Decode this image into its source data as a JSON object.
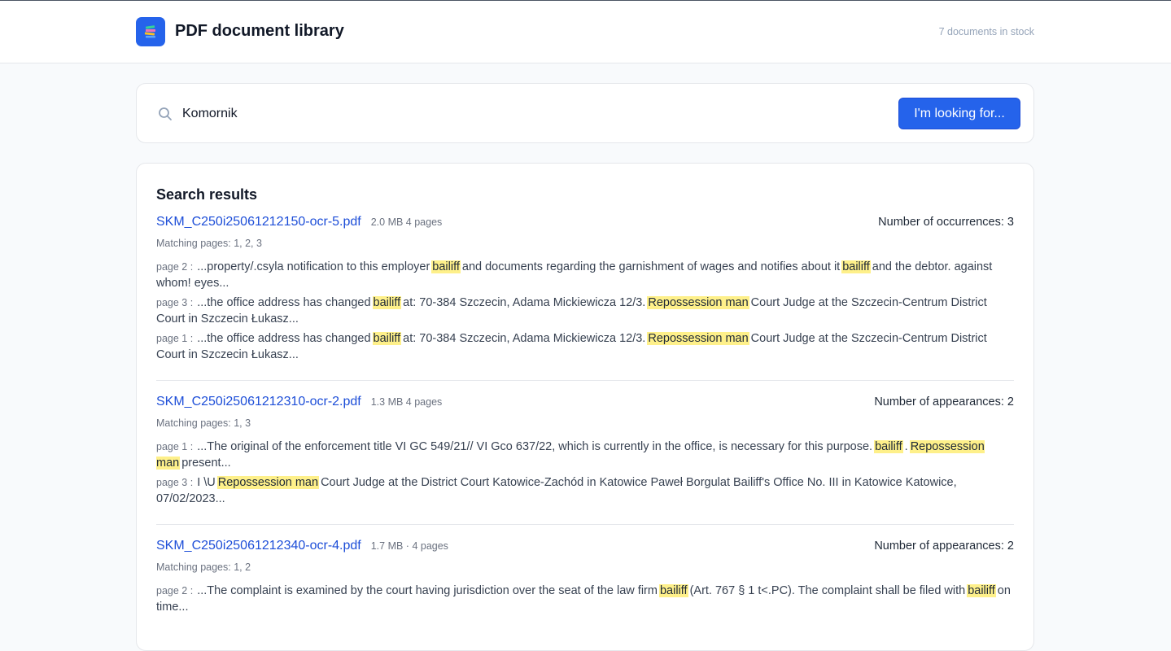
{
  "header": {
    "title": "PDF document library",
    "stock": "7 documents in stock"
  },
  "search": {
    "value": "Komornik",
    "button": "I'm looking for..."
  },
  "results": {
    "heading": "Search results",
    "items": [
      {
        "file": "SKM_C250i25061212150-ocr-5.pdf",
        "meta": "2.0 MB 4 pages",
        "count_label": "Number of occurrences: 3",
        "matching": "Matching pages: 1, 2, 3",
        "snippets": [
          {
            "label": "page 2 :",
            "parts": [
              {
                "t": "...property/.csyla notification to this employer"
              },
              {
                "t": "bailiff",
                "hl": true
              },
              {
                "t": "and documents regarding the garnishment of wages and notifies about it"
              },
              {
                "t": "bailiff",
                "hl": true
              },
              {
                "t": "and the debtor. against whom! eyes..."
              }
            ]
          },
          {
            "label": "page 3 :",
            "parts": [
              {
                "t": "...the office address has changed"
              },
              {
                "t": "bailiff",
                "hl": true
              },
              {
                "t": "at: 70-384 Szczecin, Adama Mickiewicza 12/3."
              },
              {
                "t": "Repossession man",
                "hl": true
              },
              {
                "t": "Court Judge at the Szczecin-Centrum District Court in Szczecin Łukasz..."
              }
            ]
          },
          {
            "label": "page 1 :",
            "parts": [
              {
                "t": "...the office address has changed"
              },
              {
                "t": "bailiff",
                "hl": true
              },
              {
                "t": "at: 70-384 Szczecin, Adama Mickiewicza 12/3."
              },
              {
                "t": "Repossession man",
                "hl": true
              },
              {
                "t": "Court Judge at the Szczecin-Centrum District Court in Szczecin Łukasz..."
              }
            ]
          }
        ]
      },
      {
        "file": "SKM_C250i25061212310-ocr-2.pdf",
        "meta": "1.3 MB 4 pages",
        "count_label": "Number of appearances: 2",
        "matching": "Matching pages: 1, 3",
        "snippets": [
          {
            "label": "page 1 :",
            "parts": [
              {
                "t": "...The original of the enforcement title VI GC 549/21// VI Gco 637/22, which is currently in the office, is necessary for this purpose."
              },
              {
                "t": "bailiff",
                "hl": true
              },
              {
                "t": "."
              },
              {
                "t": "Repossession man",
                "hl": true
              },
              {
                "t": "present..."
              }
            ]
          },
          {
            "label": "page 3 :",
            "parts": [
              {
                "t": "I \\U"
              },
              {
                "t": "Repossession man",
                "hl": true
              },
              {
                "t": "Court Judge at the District Court Katowice-Zachód in Katowice Paweł Borgulat Bailiff's Office No. III in Katowice Katowice, 07/02/2023..."
              }
            ]
          }
        ]
      },
      {
        "file": "SKM_C250i25061212340-ocr-4.pdf",
        "meta": "1.7 MB · 4 pages",
        "count_label": "Number of appearances: 2",
        "matching": "Matching pages: 1, 2",
        "snippets": [
          {
            "label": "page 2 :",
            "parts": [
              {
                "t": "...The complaint is examined by the court having jurisdiction over the seat of the law firm"
              },
              {
                "t": "bailiff",
                "hl": true
              },
              {
                "t": "(Art. 767 § 1 t<.PC). The complaint shall be filed with"
              },
              {
                "t": "bailiff",
                "hl": true
              },
              {
                "t": "on time..."
              }
            ]
          }
        ]
      }
    ]
  },
  "colors": {
    "accent": "#2563eb",
    "link": "#1d4ed8",
    "highlight": "#fef08a"
  },
  "icons": {
    "logo": "book-stack-icon",
    "search": "search-icon"
  }
}
